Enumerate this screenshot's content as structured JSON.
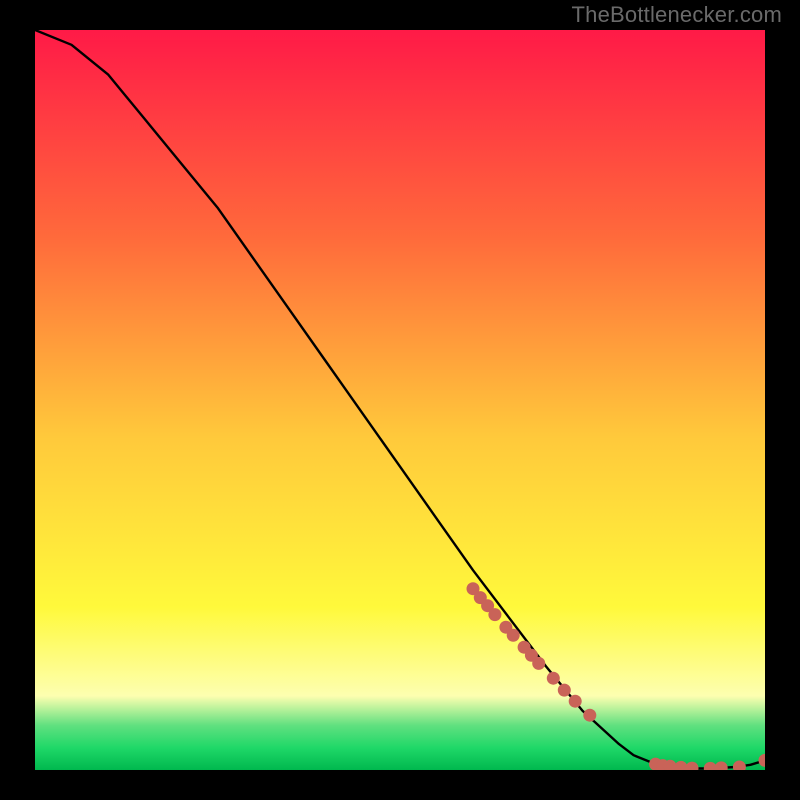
{
  "watermark": "TheBottlenecker.com",
  "colors": {
    "bg": "#000000",
    "line": "#000000",
    "dot": "#c96358",
    "grad_top": "#ff1a47",
    "grad_upper": "#ff6a3b",
    "grad_mid": "#ffc93b",
    "grad_lower": "#fff93b",
    "grad_pale": "#fdffb0",
    "grad_green1": "#5fe07f",
    "grad_green2": "#1fd868",
    "grad_bottom": "#00b84e"
  },
  "chart_data": {
    "type": "line",
    "title": "",
    "xlabel": "",
    "ylabel": "",
    "xlim": [
      0,
      100
    ],
    "ylim": [
      0,
      100
    ],
    "series": [
      {
        "name": "curve",
        "x": [
          0,
          5,
          10,
          15,
          20,
          25,
          30,
          35,
          40,
          45,
          50,
          55,
          60,
          65,
          70,
          75,
          80,
          82,
          85,
          88,
          90,
          92,
          94,
          96,
          98,
          100
        ],
        "y": [
          100,
          98,
          94,
          88,
          82,
          76,
          69,
          62,
          55,
          48,
          41,
          34,
          27,
          20.5,
          14,
          8,
          3.5,
          2.0,
          0.8,
          0.3,
          0.2,
          0.2,
          0.3,
          0.4,
          0.7,
          1.3
        ]
      },
      {
        "name": "dots",
        "x": [
          60,
          61,
          62,
          63,
          64.5,
          65.5,
          67,
          68,
          69,
          71,
          72.5,
          74,
          76,
          85,
          86,
          87,
          88.5,
          90,
          92.5,
          94,
          96.5,
          100
        ],
        "y": [
          24.5,
          23.3,
          22.2,
          21,
          19.3,
          18.2,
          16.6,
          15.5,
          14.4,
          12.4,
          10.8,
          9.3,
          7.4,
          0.8,
          0.6,
          0.5,
          0.35,
          0.25,
          0.22,
          0.28,
          0.4,
          1.3
        ]
      }
    ]
  }
}
